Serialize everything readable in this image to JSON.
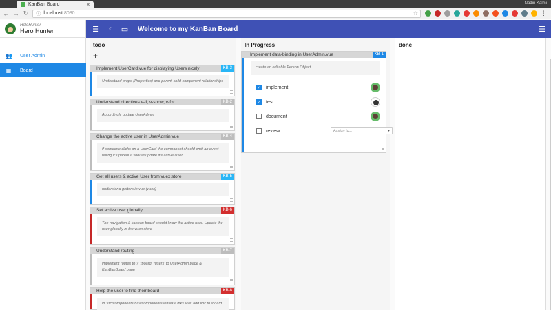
{
  "browser": {
    "tab_title": "KanBan Board",
    "url_host": "localhost",
    "url_port": ":8080",
    "user": "Nadin Kalmi"
  },
  "drawer": {
    "profile_sub": "HeloHunter",
    "profile_name": "Hero Hunter",
    "items": [
      {
        "label": "User Admin",
        "icon": "users-icon"
      },
      {
        "label": "Board",
        "icon": "dashboard-icon"
      }
    ]
  },
  "appbar": {
    "title": "Welcome to my KanBan Board"
  },
  "columns": {
    "todo": {
      "title": "todo",
      "cards": [
        {
          "title": "Implement UserCard.vue for displaying Users nicely",
          "badge": "KB-3",
          "badge_color": "#29b6f6",
          "bar_color": "#1e88e5",
          "desc": "Understand props (Properties) and parent-child component relationships"
        },
        {
          "title": "Understand directives v-if, v-show, v-for",
          "badge": "KB-2",
          "badge_color": "#bdbdbd",
          "bar_color": "#bdbdbd",
          "desc": "Accordingly update UserAdmin"
        },
        {
          "title": "Change the active user in UserAdmin.vue",
          "badge": "KB-4",
          "badge_color": "#bdbdbd",
          "bar_color": "#bdbdbd",
          "desc": "if someone clicks on a UserCard the component should emit an event telling it's parent it should update it's active User"
        },
        {
          "title": "Get all users & active User from vuex store",
          "badge": "KB-5",
          "badge_color": "#29b6f6",
          "bar_color": "#1e88e5",
          "desc": "understand getters in vue (vuex)"
        },
        {
          "title": "Set active user globally",
          "badge": "KB-6",
          "badge_color": "#d32f2f",
          "bar_color": "#c62828",
          "desc": "The navigation & kanban board should know the active user. Update the user globally in the vuex store"
        },
        {
          "title": "Understand routing",
          "badge": "KB-7",
          "badge_color": "#bdbdbd",
          "bar_color": "#bdbdbd",
          "desc": "implement routes to '/' '/board' '/users' to UserAdmin page & KanBanBoard page"
        },
        {
          "title": "Help the user to find their board",
          "badge": "KB-8",
          "badge_color": "#d32f2f",
          "bar_color": "#c62828",
          "desc": "in 'src/components/nav/components/leftNavLinks.vue' add link to /board"
        }
      ]
    },
    "progress": {
      "title": "In Progress",
      "card": {
        "title": "Implement data-binding in UserAdmin.vue",
        "badge": "KB-1",
        "desc": "create an editable Person Object",
        "tasks": [
          {
            "label": "implement",
            "checked": true
          },
          {
            "label": "test",
            "checked": true
          },
          {
            "label": "document",
            "checked": false
          },
          {
            "label": "review",
            "checked": false
          }
        ],
        "assign_placeholder": "Assign to..."
      }
    },
    "done": {
      "title": "done"
    }
  }
}
